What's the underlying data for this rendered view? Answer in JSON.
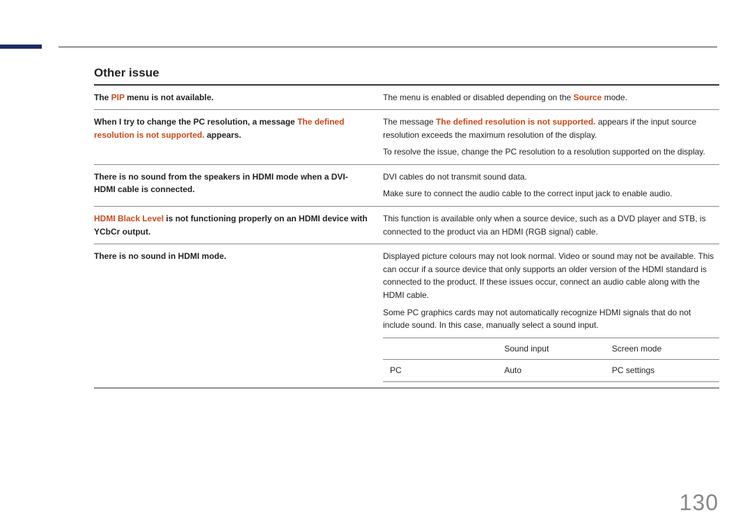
{
  "heading": "Other issue",
  "rows": [
    {
      "issue_parts": [
        {
          "t": "The ",
          "b": true
        },
        {
          "t": "PIP",
          "b": true,
          "o": true
        },
        {
          "t": " menu is not available.",
          "b": true
        }
      ],
      "desc_paras": [
        [
          {
            "t": "The menu is enabled or disabled depending on the "
          },
          {
            "t": "Source",
            "b": true,
            "o": true
          },
          {
            "t": " mode."
          }
        ]
      ]
    },
    {
      "issue_parts": [
        {
          "t": "When I try to change the PC resolution, a message ",
          "b": true
        },
        {
          "t": "The defined resolution is not supported.",
          "b": true,
          "o": true
        },
        {
          "t": " appears.",
          "b": true
        }
      ],
      "desc_paras": [
        [
          {
            "t": "The message "
          },
          {
            "t": "The defined resolution is not supported.",
            "b": true,
            "o": true
          },
          {
            "t": " appears if the input source resolution exceeds the maximum resolution of the display."
          }
        ],
        [
          {
            "t": "To resolve the issue, change the PC resolution to a resolution supported on the display."
          }
        ]
      ]
    },
    {
      "issue_parts": [
        {
          "t": "There is no sound from the speakers in HDMI mode when a DVI-HDMI cable is connected.",
          "b": true
        }
      ],
      "desc_paras": [
        [
          {
            "t": "DVI cables do not transmit sound data."
          }
        ],
        [
          {
            "t": "Make sure to connect the audio cable to the correct input jack to enable audio."
          }
        ]
      ]
    },
    {
      "issue_parts": [
        {
          "t": "HDMI Black Level",
          "b": true,
          "o": true
        },
        {
          "t": " is not functioning properly on an HDMI device with YCbCr output.",
          "b": true
        }
      ],
      "desc_paras": [
        [
          {
            "t": "This function is available only when a source device, such as a DVD player and STB, is connected to the product via an HDMI (RGB signal) cable."
          }
        ]
      ]
    },
    {
      "issue_parts": [
        {
          "t": "There is no sound in HDMI mode.",
          "b": true
        }
      ],
      "desc_paras": [
        [
          {
            "t": "Displayed picture colours may not look normal. Video or sound may not be available. This can occur if a source device that only supports an older version of the HDMI standard is connected to the product. If these issues occur, connect an audio cable along with the HDMI cable."
          }
        ],
        [
          {
            "t": "Some PC graphics cards may not automatically recognize HDMI signals that do not include sound. In this case, manually select a sound input."
          }
        ]
      ],
      "sub_table": {
        "rows": [
          [
            "",
            "Sound input",
            "Screen mode"
          ],
          [
            "PC",
            "Auto",
            "PC settings"
          ]
        ]
      }
    }
  ],
  "page_number": "130"
}
